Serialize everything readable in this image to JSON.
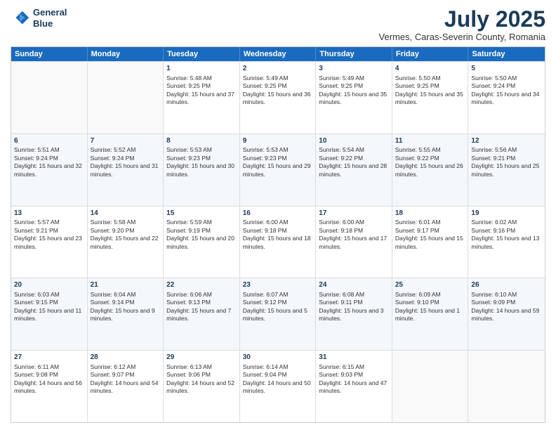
{
  "logo": {
    "line1": "General",
    "line2": "Blue"
  },
  "title": "July 2025",
  "subtitle": "Vermes, Caras-Severin County, Romania",
  "header_days": [
    "Sunday",
    "Monday",
    "Tuesday",
    "Wednesday",
    "Thursday",
    "Friday",
    "Saturday"
  ],
  "weeks": [
    [
      {
        "day": "",
        "info": ""
      },
      {
        "day": "",
        "info": ""
      },
      {
        "day": "1",
        "info": "Sunrise: 5:48 AM\nSunset: 9:25 PM\nDaylight: 15 hours and 37 minutes."
      },
      {
        "day": "2",
        "info": "Sunrise: 5:49 AM\nSunset: 9:25 PM\nDaylight: 15 hours and 36 minutes."
      },
      {
        "day": "3",
        "info": "Sunrise: 5:49 AM\nSunset: 9:25 PM\nDaylight: 15 hours and 35 minutes."
      },
      {
        "day": "4",
        "info": "Sunrise: 5:50 AM\nSunset: 9:25 PM\nDaylight: 15 hours and 35 minutes."
      },
      {
        "day": "5",
        "info": "Sunrise: 5:50 AM\nSunset: 9:24 PM\nDaylight: 15 hours and 34 minutes."
      }
    ],
    [
      {
        "day": "6",
        "info": "Sunrise: 5:51 AM\nSunset: 9:24 PM\nDaylight: 15 hours and 32 minutes."
      },
      {
        "day": "7",
        "info": "Sunrise: 5:52 AM\nSunset: 9:24 PM\nDaylight: 15 hours and 31 minutes."
      },
      {
        "day": "8",
        "info": "Sunrise: 5:53 AM\nSunset: 9:23 PM\nDaylight: 15 hours and 30 minutes."
      },
      {
        "day": "9",
        "info": "Sunrise: 5:53 AM\nSunset: 9:23 PM\nDaylight: 15 hours and 29 minutes."
      },
      {
        "day": "10",
        "info": "Sunrise: 5:54 AM\nSunset: 9:22 PM\nDaylight: 15 hours and 28 minutes."
      },
      {
        "day": "11",
        "info": "Sunrise: 5:55 AM\nSunset: 9:22 PM\nDaylight: 15 hours and 26 minutes."
      },
      {
        "day": "12",
        "info": "Sunrise: 5:56 AM\nSunset: 9:21 PM\nDaylight: 15 hours and 25 minutes."
      }
    ],
    [
      {
        "day": "13",
        "info": "Sunrise: 5:57 AM\nSunset: 9:21 PM\nDaylight: 15 hours and 23 minutes."
      },
      {
        "day": "14",
        "info": "Sunrise: 5:58 AM\nSunset: 9:20 PM\nDaylight: 15 hours and 22 minutes."
      },
      {
        "day": "15",
        "info": "Sunrise: 5:59 AM\nSunset: 9:19 PM\nDaylight: 15 hours and 20 minutes."
      },
      {
        "day": "16",
        "info": "Sunrise: 6:00 AM\nSunset: 9:18 PM\nDaylight: 15 hours and 18 minutes."
      },
      {
        "day": "17",
        "info": "Sunrise: 6:00 AM\nSunset: 9:18 PM\nDaylight: 15 hours and 17 minutes."
      },
      {
        "day": "18",
        "info": "Sunrise: 6:01 AM\nSunset: 9:17 PM\nDaylight: 15 hours and 15 minutes."
      },
      {
        "day": "19",
        "info": "Sunrise: 6:02 AM\nSunset: 9:16 PM\nDaylight: 15 hours and 13 minutes."
      }
    ],
    [
      {
        "day": "20",
        "info": "Sunrise: 6:03 AM\nSunset: 9:15 PM\nDaylight: 15 hours and 11 minutes."
      },
      {
        "day": "21",
        "info": "Sunrise: 6:04 AM\nSunset: 9:14 PM\nDaylight: 15 hours and 9 minutes."
      },
      {
        "day": "22",
        "info": "Sunrise: 6:06 AM\nSunset: 9:13 PM\nDaylight: 15 hours and 7 minutes."
      },
      {
        "day": "23",
        "info": "Sunrise: 6:07 AM\nSunset: 9:12 PM\nDaylight: 15 hours and 5 minutes."
      },
      {
        "day": "24",
        "info": "Sunrise: 6:08 AM\nSunset: 9:11 PM\nDaylight: 15 hours and 3 minutes."
      },
      {
        "day": "25",
        "info": "Sunrise: 6:09 AM\nSunset: 9:10 PM\nDaylight: 15 hours and 1 minute."
      },
      {
        "day": "26",
        "info": "Sunrise: 6:10 AM\nSunset: 9:09 PM\nDaylight: 14 hours and 59 minutes."
      }
    ],
    [
      {
        "day": "27",
        "info": "Sunrise: 6:11 AM\nSunset: 9:08 PM\nDaylight: 14 hours and 56 minutes."
      },
      {
        "day": "28",
        "info": "Sunrise: 6:12 AM\nSunset: 9:07 PM\nDaylight: 14 hours and 54 minutes."
      },
      {
        "day": "29",
        "info": "Sunrise: 6:13 AM\nSunset: 9:06 PM\nDaylight: 14 hours and 52 minutes."
      },
      {
        "day": "30",
        "info": "Sunrise: 6:14 AM\nSunset: 9:04 PM\nDaylight: 14 hours and 50 minutes."
      },
      {
        "day": "31",
        "info": "Sunrise: 6:15 AM\nSunset: 9:03 PM\nDaylight: 14 hours and 47 minutes."
      },
      {
        "day": "",
        "info": ""
      },
      {
        "day": "",
        "info": ""
      }
    ]
  ]
}
